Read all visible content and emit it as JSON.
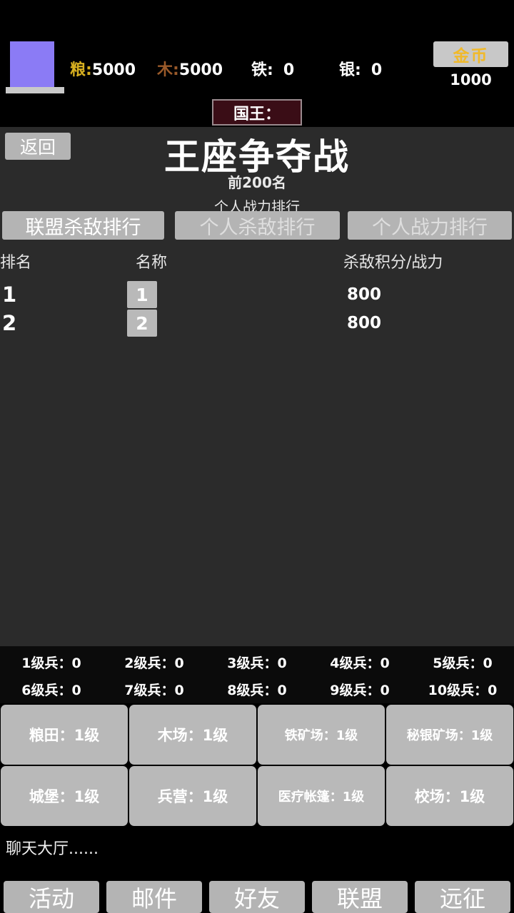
{
  "topbar": {
    "avatar_name": "player-portrait",
    "resources": [
      {
        "key": "grain",
        "label": "粮:",
        "value": "5000",
        "color": "#d8b020"
      },
      {
        "key": "wood",
        "label": "木:",
        "value": "5000",
        "color": "#9a5a2a"
      },
      {
        "key": "iron",
        "label": "铁:",
        "value": "0",
        "color": "#ffffff"
      },
      {
        "key": "silver",
        "label": "银:",
        "value": "0",
        "color": "#ffffff"
      }
    ],
    "gold_button_label": "金币",
    "gold_amount": "1000",
    "gold_label_color": "#f0b92a",
    "king_banner": "国王："
  },
  "panel": {
    "back_label": "返回",
    "title": "王座争夺战",
    "subtitle_count": "前200名",
    "subtitle_mode": "个人战力排行",
    "tabs": [
      {
        "label": "联盟杀敌排行",
        "active": true
      },
      {
        "label": "个人杀敌排行",
        "active": false
      },
      {
        "label": "个人战力排行",
        "active": false
      }
    ],
    "table": {
      "headers": {
        "rank": "排名",
        "name": "名称",
        "score": "杀敌积分/战力"
      },
      "rows": [
        {
          "rank": "1",
          "name": "1",
          "score": "800"
        },
        {
          "rank": "2",
          "name": "2",
          "score": "800"
        }
      ]
    }
  },
  "troops": [
    {
      "label": "1级兵：0"
    },
    {
      "label": "2级兵：0"
    },
    {
      "label": "3级兵：0"
    },
    {
      "label": "4级兵：0"
    },
    {
      "label": "5级兵：0"
    },
    {
      "label": "6级兵：0"
    },
    {
      "label": "7级兵：0"
    },
    {
      "label": "8级兵：0"
    },
    {
      "label": "9级兵：0"
    },
    {
      "label": "10级兵：0"
    }
  ],
  "buildings": [
    {
      "label": "粮田：1级",
      "size": "lg"
    },
    {
      "label": "木场：1级",
      "size": "lg"
    },
    {
      "label": "铁矿场：1级",
      "size": "sm"
    },
    {
      "label": "秘银矿场：1级",
      "size": "sm"
    },
    {
      "label": "城堡：1级",
      "size": "lg"
    },
    {
      "label": "兵营：1级",
      "size": "lg"
    },
    {
      "label": "医疗帐篷：1级",
      "size": "sm"
    },
    {
      "label": "校场：1级",
      "size": "lg"
    }
  ],
  "chat": {
    "text": "聊天大厅......"
  },
  "bottom_nav": [
    {
      "label": "活动"
    },
    {
      "label": "邮件"
    },
    {
      "label": "好友"
    },
    {
      "label": "联盟"
    },
    {
      "label": "远征"
    }
  ]
}
